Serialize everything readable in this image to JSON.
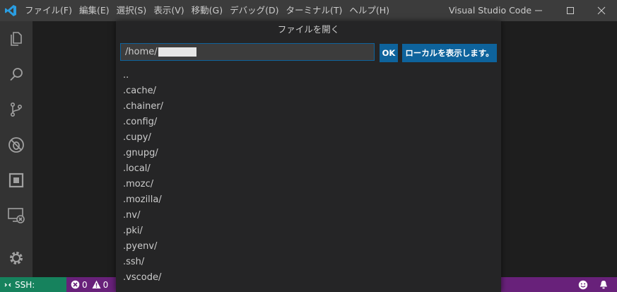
{
  "titlebar": {
    "menu": [
      "ファイル(F)",
      "編集(E)",
      "選択(S)",
      "表示(V)",
      "移動(G)",
      "デバッグ(D)",
      "ターミナル(T)",
      "ヘルプ(H)"
    ],
    "app_title": "Visual Studio Code"
  },
  "dialog": {
    "title": "ファイルを開く",
    "path_value": "/home/",
    "ok_label": "OK",
    "show_local_label": "ローカルを表示します。",
    "files": [
      {
        "name": ".."
      },
      {
        "name": ".cache/"
      },
      {
        "name": ".chainer/"
      },
      {
        "name": ".config/"
      },
      {
        "name": ".cupy/"
      },
      {
        "name": ".gnupg/"
      },
      {
        "name": ".local/"
      },
      {
        "name": ".mozc/"
      },
      {
        "name": ".mozilla/"
      },
      {
        "name": ".nv/"
      },
      {
        "name": ".pki/"
      },
      {
        "name": ".pyenv/"
      },
      {
        "name": ".ssh/"
      },
      {
        "name": ".vscode/"
      }
    ]
  },
  "statusbar": {
    "remote_label": "SSH:",
    "errors": "0",
    "warnings": "0"
  },
  "colors": {
    "accent": "#0e639c",
    "statusbar": "#68217a",
    "remote": "#16825d",
    "titlebar": "#3c3c3c",
    "activitybar": "#333333"
  },
  "icons": [
    "vscode-logo-icon",
    "minimize-icon",
    "maximize-icon",
    "close-icon",
    "explorer-icon",
    "search-icon",
    "source-control-icon",
    "debug-icon",
    "extensions-icon",
    "remote-explorer-icon",
    "gear-icon",
    "remote-icon",
    "error-icon",
    "warning-icon",
    "smiley-icon",
    "bell-icon"
  ]
}
